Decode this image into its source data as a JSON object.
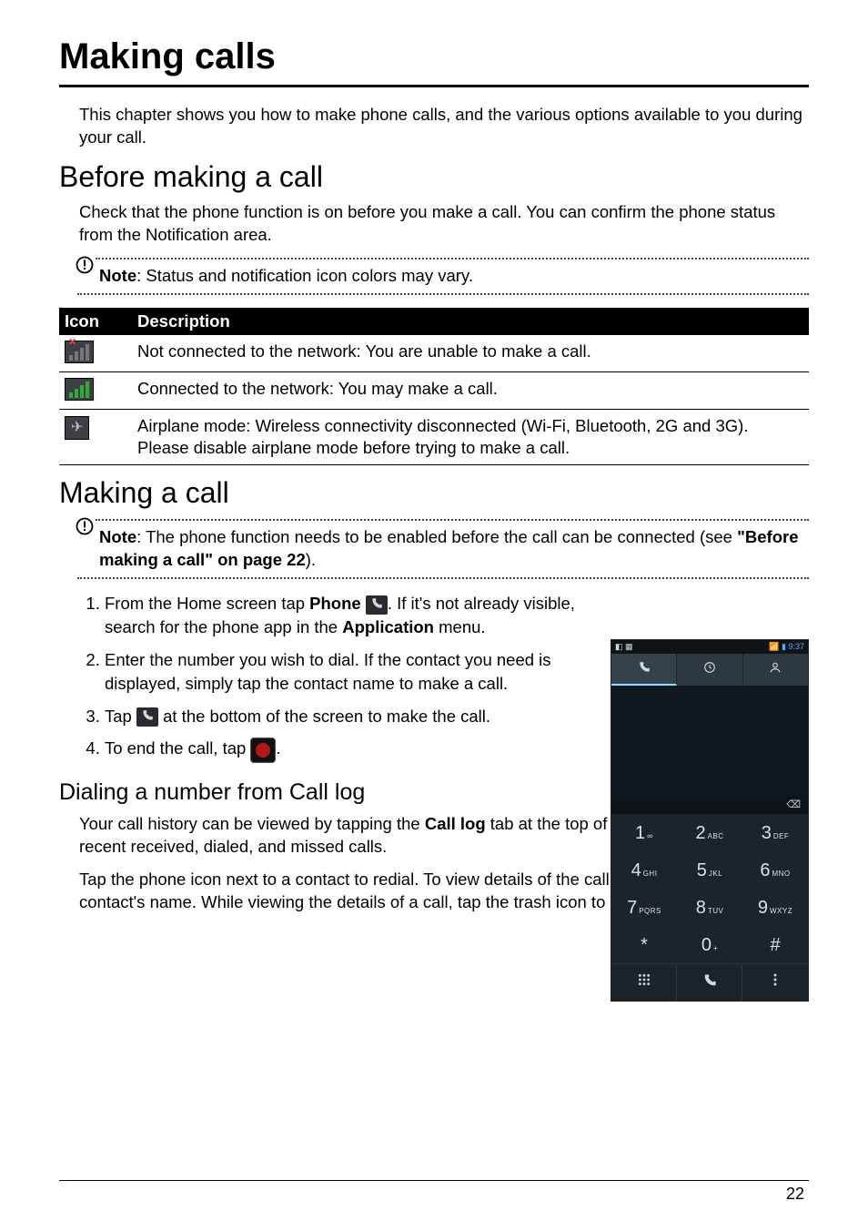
{
  "page": {
    "title": "Making calls",
    "intro": "This chapter shows you how to make phone calls, and the various options available to you during your call.",
    "number": "22"
  },
  "before": {
    "heading": "Before making a call",
    "body": "Check that the phone function is on before you make a call. You can confirm the phone status from the Notification area.",
    "note_label": "Note",
    "note_text": ": Status and notification icon colors may vary."
  },
  "table": {
    "head_icon": "Icon",
    "head_desc": "Description",
    "rows": [
      {
        "icon": "no-signal-icon",
        "desc": "Not connected to the network: You are unable to make a call."
      },
      {
        "icon": "signal-icon",
        "desc": "Connected to the network: You may make a call."
      },
      {
        "icon": "airplane-icon",
        "desc": "Airplane mode: Wireless connectivity disconnected (Wi-Fi, Bluetooth, 2G and 3G). Please disable airplane mode before trying to make a call."
      }
    ]
  },
  "making": {
    "heading": "Making a call",
    "note_label": "Note",
    "note_text_1": ": The phone function needs to be enabled before the call can be connected (see ",
    "note_link": "\"Before making a call\" on page 22",
    "note_text_2": ").",
    "step1a": "From the Home screen tap ",
    "step1_phone": "Phone",
    "step1b": ". If it's not already visible, search for the phone app in the ",
    "step1_app": "Application",
    "step1c": " menu.",
    "step2": "Enter the number you wish to dial. If the contact you need is displayed, simply tap the contact name to make a call.",
    "step3a": "Tap ",
    "step3b": " at the bottom of the screen to make the call.",
    "step4a": "To end the call, tap ",
    "step4b": "."
  },
  "dialing": {
    "heading": "Dialing a number from Call log",
    "p1a": "Your call history can be viewed by tapping the ",
    "p1_bold": "Call log",
    "p1b": " tab at the top of the screen. It displays recent received, dialed, and missed calls.",
    "p2": "Tap the phone icon next to a contact to redial. To view details of the call, tap the number or contact's name. While viewing the details of a call, tap the trash icon to"
  },
  "phone_mock": {
    "status_left": "◧ ▦",
    "status_right": "📶 ▮ 9:37",
    "keys": [
      {
        "d": "1",
        "l": "∞"
      },
      {
        "d": "2",
        "l": "ABC"
      },
      {
        "d": "3",
        "l": "DEF"
      },
      {
        "d": "4",
        "l": "GHI"
      },
      {
        "d": "5",
        "l": "JKL"
      },
      {
        "d": "6",
        "l": "MNO"
      },
      {
        "d": "7",
        "l": "PQRS"
      },
      {
        "d": "8",
        "l": "TUV"
      },
      {
        "d": "9",
        "l": "WXYZ"
      },
      {
        "d": "*",
        "l": ""
      },
      {
        "d": "0",
        "l": "+"
      },
      {
        "d": "#",
        "l": ""
      }
    ],
    "backspace": "⌫"
  }
}
